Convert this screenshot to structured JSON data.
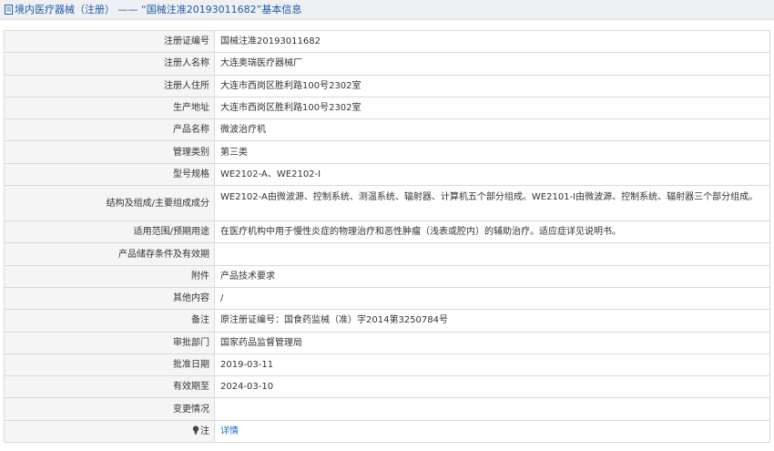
{
  "header": {
    "title": "境内医疗器械（注册） —— “国械注准20193011682”基本信息",
    "icon": "document-icon"
  },
  "rows": [
    {
      "label": "注册证编号",
      "value": "国械注准20193011682"
    },
    {
      "label": "注册人名称",
      "value": "大连奥瑞医疗器械厂"
    },
    {
      "label": "注册人住所",
      "value": "大连市西岗区胜利路100号2302室"
    },
    {
      "label": "生产地址",
      "value": "大连市西岗区胜利路100号2302室"
    },
    {
      "label": "产品名称",
      "value": "微波治疗机"
    },
    {
      "label": "管理类别",
      "value": "第三类"
    },
    {
      "label": "型号规格",
      "value": "WE2102-A、WE2102-I"
    },
    {
      "label": "结构及组成/主要组成成分",
      "value": "WE2102-A由微波源、控制系统、测温系统、辐射器、计算机五个部分组成。WE2101-I由微波源、控制系统、辐射器三个部分组成。"
    },
    {
      "label": "适用范围/预期用途",
      "value": "在医疗机构中用于慢性炎症的物理治疗和恶性肿瘤（浅表或腔内）的辅助治疗。适应症详见说明书。"
    },
    {
      "label": "产品储存条件及有效期",
      "value": ""
    },
    {
      "label": "附件",
      "value": "产品技术要求"
    },
    {
      "label": "其他内容",
      "value": "/"
    },
    {
      "label": "备注",
      "value": "原注册证编号：国食药监械（准）字2014第3250784号"
    },
    {
      "label": "审批部门",
      "value": "国家药品监督管理局"
    },
    {
      "label": "批准日期",
      "value": "2019-03-11"
    },
    {
      "label": "有效期至",
      "value": "2024-03-10"
    },
    {
      "label": "变更情况",
      "value": ""
    }
  ],
  "note": {
    "label": "注",
    "icon": "lightbulb-icon",
    "link_text": "详情"
  }
}
